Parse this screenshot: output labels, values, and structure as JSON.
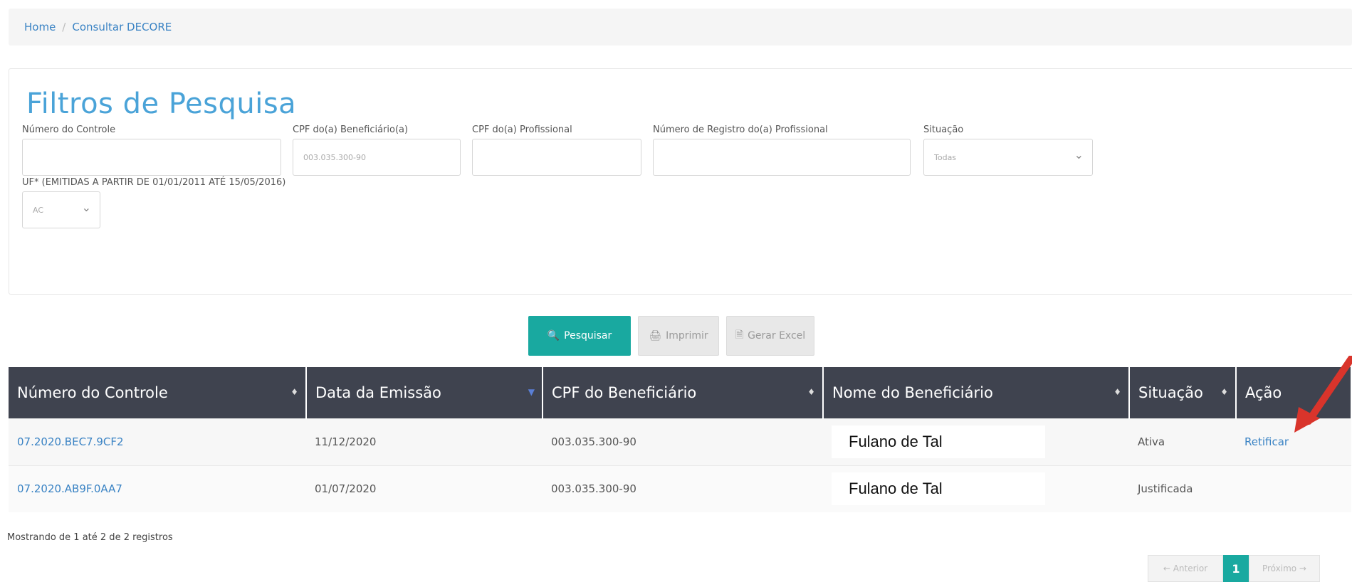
{
  "breadcrumb": {
    "home": "Home",
    "separator": "/",
    "current": "Consultar DECORE"
  },
  "filters": {
    "title": "Filtros de Pesquisa",
    "numero_controle_label": "Número do Controle",
    "numero_controle_value": "",
    "cpf_beneficiario_label": "CPF do(a) Beneficiário(a)",
    "cpf_beneficiario_value": "003.035.300-90",
    "cpf_profissional_label": "CPF do(a) Profissional",
    "cpf_profissional_value": "",
    "registro_profissional_label": "Número de Registro do(a) Profissional",
    "registro_profissional_value": "",
    "situacao_label": "Situação",
    "situacao_value": "Todas",
    "uf_label": "UF* (EMITIDAS A PARTIR DE 01/01/2011 ATÉ 15/05/2016)",
    "uf_value": "AC"
  },
  "buttons": {
    "pesquisar": "Pesquisar",
    "imprimir": "Imprimir",
    "gerar_excel": "Gerar Excel"
  },
  "table": {
    "headers": [
      "Número do Controle",
      "Data da Emissão",
      "CPF do Beneficiário",
      "Nome do Beneficiário",
      "Situação",
      "Ação"
    ],
    "rows": [
      {
        "controle": "07.2020.BEC7.9CF2",
        "data": "11/12/2020",
        "cpf": "003.035.300-90",
        "nome": "Fulano de Tal",
        "situacao": "Ativa",
        "acao": "Retificar"
      },
      {
        "controle": "07.2020.AB9F.0AA7",
        "data": "01/07/2020",
        "cpf": "003.035.300-90",
        "nome": "Fulano de Tal",
        "situacao": "Justificada",
        "acao": ""
      }
    ]
  },
  "info": "Mostrando de 1 até 2 de 2 registros",
  "pagination": {
    "prev": "← Anterior",
    "current": "1",
    "next": "Próximo →"
  },
  "colors": {
    "accent": "#19a9a0",
    "header_bg": "#3f434f",
    "link": "#3a83c4",
    "title": "#4aa3d8",
    "arrow": "#d9342b"
  }
}
